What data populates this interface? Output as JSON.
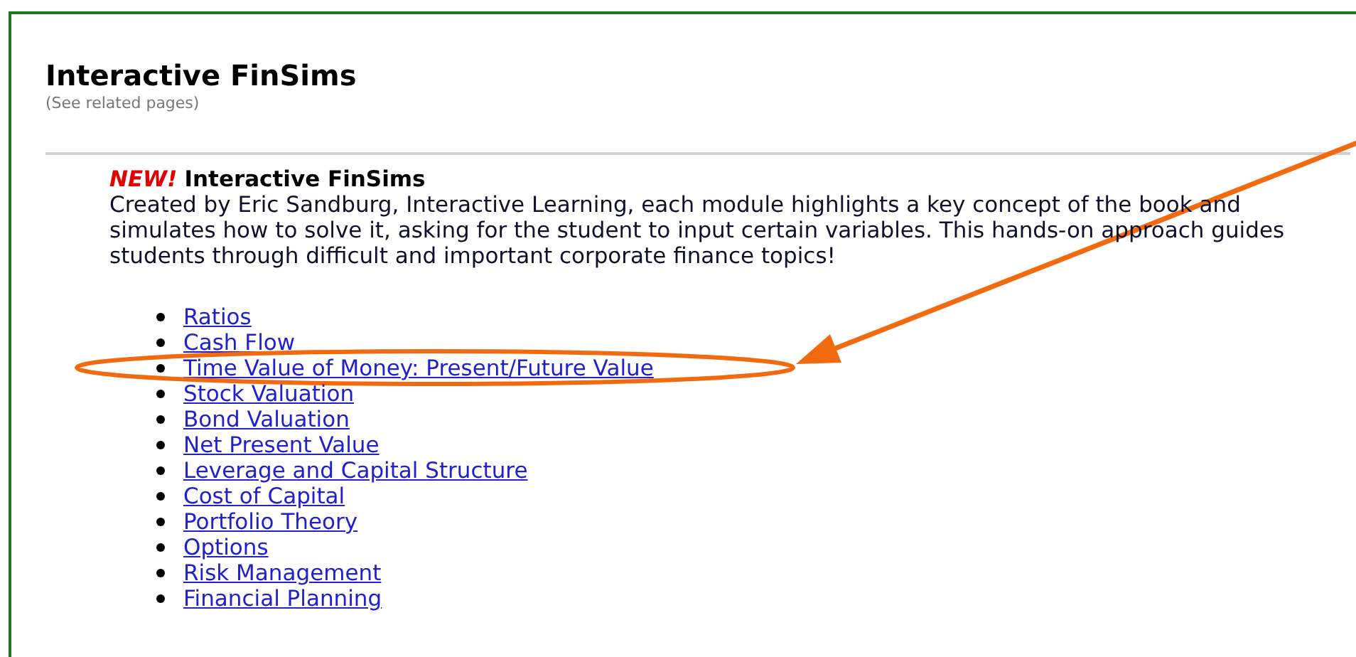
{
  "page": {
    "title": "Interactive FinSims",
    "subtitle": "(See related pages)"
  },
  "intro": {
    "badge": "NEW!",
    "heading": "Interactive FinSims",
    "text": "Created by Eric Sandburg, Interactive Learning, each module highlights a key concept of the book and simulates how to solve it, asking for the student to input certain variables. This hands-on approach guides students through difficult and important corporate finance topics!"
  },
  "modules": [
    {
      "label": "Ratios",
      "highlighted": false
    },
    {
      "label": "Cash Flow",
      "highlighted": false
    },
    {
      "label": "Time Value of Money: Present/Future Value",
      "highlighted": true
    },
    {
      "label": "Stock Valuation",
      "highlighted": false
    },
    {
      "label": "Bond Valuation",
      "highlighted": false
    },
    {
      "label": "Net Present Value",
      "highlighted": false
    },
    {
      "label": "Leverage and Capital Structure",
      "highlighted": false
    },
    {
      "label": "Cost of Capital",
      "highlighted": false
    },
    {
      "label": "Portfolio Theory",
      "highlighted": false
    },
    {
      "label": "Options",
      "highlighted": false
    },
    {
      "label": "Risk Management",
      "highlighted": false
    },
    {
      "label": "Financial Planning",
      "highlighted": false
    }
  ]
}
